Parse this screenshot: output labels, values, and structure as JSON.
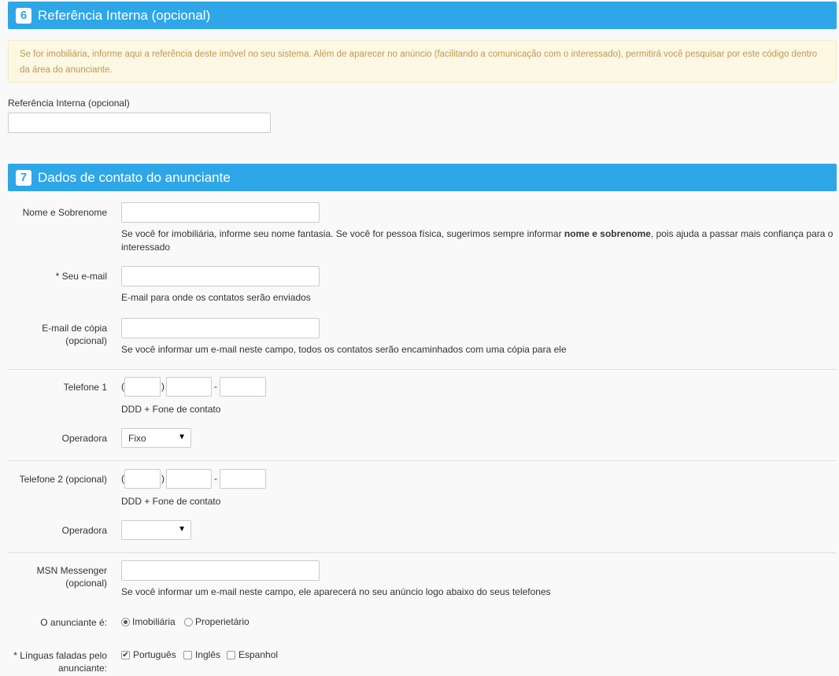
{
  "section6": {
    "number": "6",
    "title": "Referência Interna (opcional)",
    "alert": "Se for imobiliária, informe aqui a referência deste imóvel no seu sistema. Além de aparecer no anúncio (facilitando a comunicação com o interessado), permitirá você pesquisar por este código dentro da área do anunciante.",
    "field_label": "Referência Interna (opcional)",
    "field_value": ""
  },
  "section7": {
    "number": "7",
    "title": "Dados de contato do anunciante",
    "name": {
      "label": "Nome e Sobrenome",
      "value": "",
      "help_pre": "Se você for imobiliária, informe seu nome fantasia. Se você for pessoa física, sugerimos sempre informar ",
      "help_bold": "nome e sobrenome",
      "help_post": ", pois ajuda a passar mais confiança para o interessado"
    },
    "email": {
      "label": "* Seu e-mail",
      "value": "",
      "help": "E-mail para onde os contatos serão enviados"
    },
    "email_copy": {
      "label": "E-mail de cópia (opcional)",
      "value": "",
      "help": "Se você informar um e-mail neste campo, todos os contatos serão encaminhados com uma cópia para ele"
    },
    "phone1": {
      "label": "Telefone 1",
      "open_paren": "(",
      "close_paren": ")",
      "dash": "-",
      "help": "DDD + Fone de contato",
      "carrier_label": "Operadora",
      "carrier_value": "Fixo"
    },
    "phone2": {
      "label": "Telefone 2 (opcional)",
      "open_paren": "(",
      "close_paren": ")",
      "dash": "-",
      "help": "DDD + Fone de contato",
      "carrier_label": "Operadora",
      "carrier_value": ""
    },
    "msn": {
      "label": "MSN Messenger (opcional)",
      "value": "",
      "help": "Se você informar um e-mail neste campo, ele aparecerá no seu anúncio logo abaixo do seus telefones"
    },
    "advertiser_type": {
      "label": "O anunciante é:",
      "options": [
        {
          "label": "Imobiliária",
          "checked": true
        },
        {
          "label": "Properietário",
          "checked": false
        }
      ]
    },
    "languages": {
      "label": "* Línguas faladas pelo anunciante:",
      "options": [
        {
          "label": "Português",
          "checked": true
        },
        {
          "label": "Inglês",
          "checked": false
        },
        {
          "label": "Espanhol",
          "checked": false
        }
      ]
    },
    "select_arrow": "▼",
    "check_mark": "✔"
  },
  "colors": {
    "header_bg": "#2ea6e8",
    "alert_bg": "#fcf8e3",
    "alert_text": "#c09853"
  }
}
